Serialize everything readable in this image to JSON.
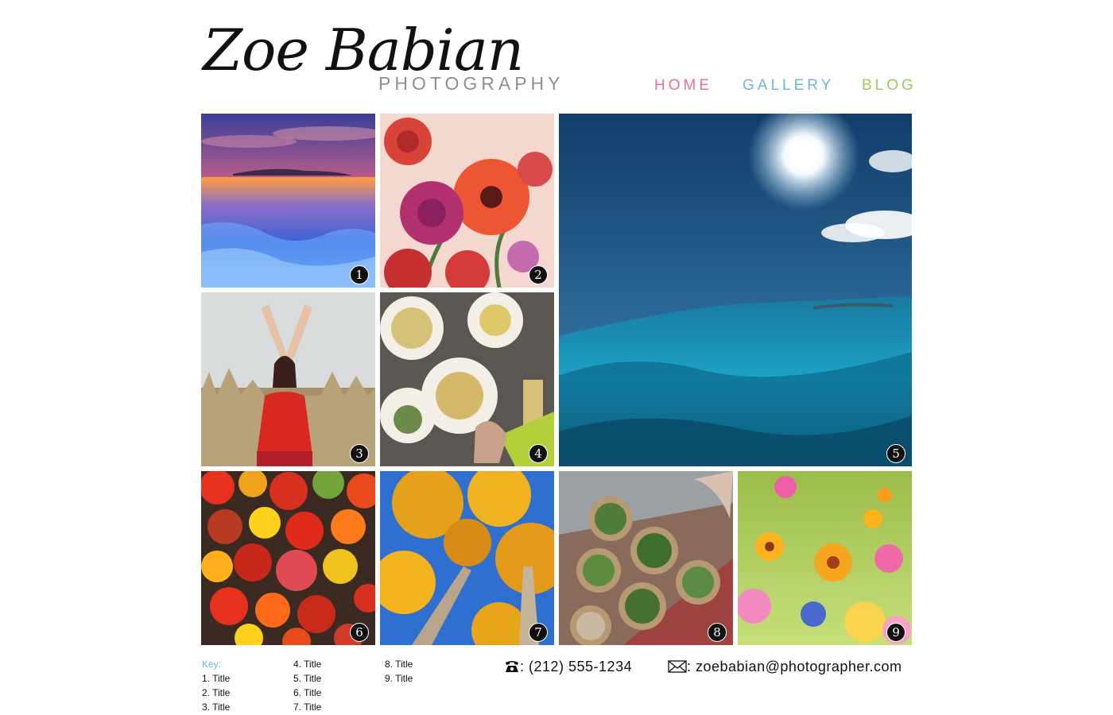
{
  "header": {
    "name": "Zoe Babian",
    "subtitle": "PHOTOGRAPHY"
  },
  "nav": [
    {
      "label": "HOME",
      "color": "#e9738f"
    },
    {
      "label": "GALLERY",
      "color": "#6fb6e0"
    },
    {
      "label": "BLOG",
      "color": "#9dcb5b"
    }
  ],
  "gallery": [
    {
      "number": "1",
      "subject": "sunset over icy lake"
    },
    {
      "number": "2",
      "subject": "ranunculus flowers"
    },
    {
      "number": "3",
      "subject": "woman dancing in tall grass"
    },
    {
      "number": "4",
      "subject": "food on table"
    },
    {
      "number": "5",
      "subject": "sun over ocean waves"
    },
    {
      "number": "6",
      "subject": "heirloom tomatoes"
    },
    {
      "number": "7",
      "subject": "golden trees against blue sky"
    },
    {
      "number": "8",
      "subject": "baskets of herbs"
    },
    {
      "number": "9",
      "subject": "wildflowers"
    }
  ],
  "key": {
    "title": "Key:",
    "items": [
      "1. Title",
      "2. Title",
      "3. Title",
      "4. Title",
      "5. Title",
      "6. Title",
      "7. Title",
      "8. Title",
      "9. Title"
    ]
  },
  "contact": {
    "phone": ": (212) 555-1234",
    "email": ": zoebabian@photographer.com"
  },
  "icons": {
    "phone": "phone-icon",
    "email": "envelope-icon"
  }
}
